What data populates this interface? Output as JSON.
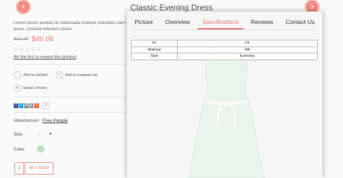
{
  "product": {
    "title": "Classic Evening Dress",
    "description": "Lorem ipsum aenean at malesuada tristique phasellus nam sit purus, conubia interdum luctus",
    "old_price": "$45.00",
    "new_price": "$40.00",
    "review_link": "Be the first to review this product"
  },
  "actions": {
    "wishlist": "Add to wishlist",
    "compare": "Add to compare list",
    "email": "Email a friend"
  },
  "social": {
    "count": "0"
  },
  "manufacturer": {
    "label": "Manufacturer:",
    "name": "Free People"
  },
  "options": {
    "size_label": "Size",
    "size_value": "...",
    "color_label": "Color",
    "color_hex": "#bfe0c8"
  },
  "cart": {
    "quantity": "1",
    "buy_label": "BUY NOW"
  },
  "tabs": [
    {
      "label": "Picture"
    },
    {
      "label": "Overview"
    },
    {
      "label": "Specifications",
      "active": true
    },
    {
      "label": "Reviews"
    },
    {
      "label": "Contact Us"
    }
  ],
  "specifications": [
    {
      "key": "Fit",
      "value": "Fit"
    },
    {
      "key": "Material",
      "value": "Silk"
    },
    {
      "key": "Style",
      "value": "Everyday"
    }
  ],
  "colors": {
    "accent": "#e8786f"
  }
}
